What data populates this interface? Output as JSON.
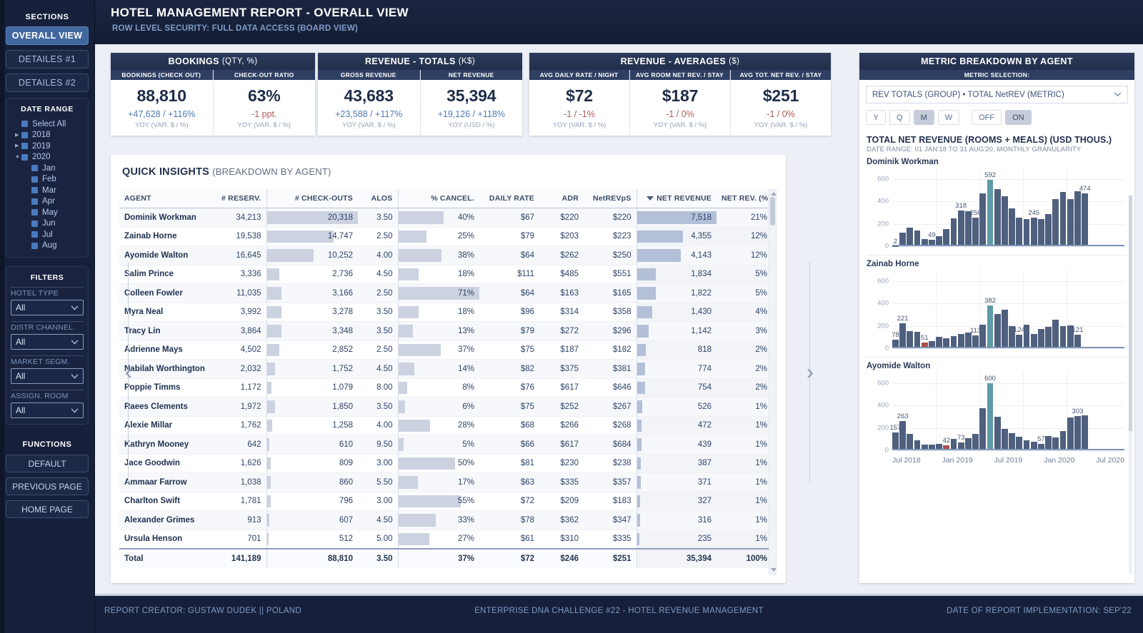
{
  "header": {
    "title": "HOTEL MANAGEMENT REPORT - OVERALL VIEW",
    "subtitle": "ROW LEVEL SECURITY: FULL DATA ACCESS (BOARD VIEW)"
  },
  "sidebar": {
    "sections_title": "SECTIONS",
    "sections": [
      {
        "label": "OVERALL VIEW",
        "active": true
      },
      {
        "label": "DETAILES #1",
        "active": false
      },
      {
        "label": "DETAILES #2",
        "active": false
      }
    ],
    "date_range_title": "DATE RANGE",
    "date_tree": [
      {
        "label": "Select All",
        "level": 1,
        "arrow": ""
      },
      {
        "label": "2018",
        "level": 1,
        "arrow": "collapsed"
      },
      {
        "label": "2019",
        "level": 1,
        "arrow": "collapsed"
      },
      {
        "label": "2020",
        "level": 1,
        "arrow": "expanded"
      },
      {
        "label": "Jan",
        "level": 2,
        "arrow": ""
      },
      {
        "label": "Feb",
        "level": 2,
        "arrow": ""
      },
      {
        "label": "Mar",
        "level": 2,
        "arrow": ""
      },
      {
        "label": "Apr",
        "level": 2,
        "arrow": ""
      },
      {
        "label": "May",
        "level": 2,
        "arrow": ""
      },
      {
        "label": "Jun",
        "level": 2,
        "arrow": ""
      },
      {
        "label": "Jul",
        "level": 2,
        "arrow": ""
      },
      {
        "label": "Aug",
        "level": 2,
        "arrow": ""
      }
    ],
    "filters_title": "FILTERS",
    "filters": [
      {
        "label": "HOTEL TYPE",
        "value": "All"
      },
      {
        "label": "DISTR CHANNEL.",
        "value": "All"
      },
      {
        "label": "MARKET SEGM.",
        "value": "All"
      },
      {
        "label": "ASSIGN. ROOM",
        "value": "All"
      }
    ],
    "functions_title": "FUNCTIONS",
    "functions": [
      {
        "label": "DEFAULT"
      },
      {
        "label": "PREVIOUS PAGE"
      },
      {
        "label": "HOME PAGE"
      }
    ]
  },
  "kpi_groups": [
    {
      "title": "BOOKINGS",
      "title_light": "(QTY, %)",
      "cells": [
        {
          "head": "BOOKINGS (CHECK OUT)",
          "value": "88,810",
          "delta": "+47,628 / +116%",
          "delta_sign": "pos",
          "note": "YOY (VAR. $ / %)"
        },
        {
          "head": "CHECK-OUT RATIO",
          "value": "63%",
          "delta": "-1 ppt.",
          "delta_sign": "neg",
          "note": "YOY (VAR. $ / %)"
        }
      ]
    },
    {
      "title": "REVENUE - TOTALS",
      "title_light": "(K$)",
      "cells": [
        {
          "head": "GROSS REVENUE",
          "value": "43,683",
          "delta": "+23,588 / +117%",
          "delta_sign": "pos",
          "note": "YOY (VAR. $ / %)"
        },
        {
          "head": "NET REVENUE",
          "value": "35,394",
          "delta": "+19,126 / +118%",
          "delta_sign": "pos",
          "note": "YOY (USD / %)"
        }
      ]
    },
    {
      "title": "REVENUE - AVERAGES",
      "title_light": "($)",
      "cells": [
        {
          "head": "AVG DAILY RATE / NIGHT",
          "value": "$72",
          "delta": "-1 / -1%",
          "delta_sign": "neg",
          "note": "YOY (VAR. $ / %)"
        },
        {
          "head": "AVG ROOM NET REV. / STAY",
          "value": "$187",
          "delta": "-1 / 0%",
          "delta_sign": "neg",
          "note": "YOY (VAR. $ / %)"
        },
        {
          "head": "AVG TOT. NET REV. / STAY",
          "value": "$251",
          "delta": "-1 / 0%",
          "delta_sign": "neg",
          "note": "YOY (VAR. $ / %)"
        }
      ]
    }
  ],
  "table": {
    "title": "QUICK INSIGHTS",
    "title_light": "(BREAKDOWN BY AGENT)",
    "columns": [
      "AGENT",
      "# RESERV.",
      "# CHECK-OUTS",
      "ALOS",
      "% CANCEL.",
      "DAILY RATE",
      "ADR",
      "NetREVpS",
      "NET REVENUE",
      "NET REV. (%)"
    ],
    "sorted_column": "NET REVENUE",
    "rows": [
      {
        "agent": "Dominik Workman",
        "reserv": "34,213",
        "checkouts": "20,318",
        "checkouts_pct": 100,
        "alos": "3.50",
        "cancel": "40%",
        "cancel_pct": 56,
        "daily_rate": "$67",
        "adr": "$220",
        "netrevps": "$220",
        "net_revenue": "7,518",
        "netrev_pct": 100,
        "net_rev_share": "21%"
      },
      {
        "agent": "Zainab Horne",
        "reserv": "19,538",
        "checkouts": "14,747",
        "checkouts_pct": 73,
        "alos": "2.50",
        "cancel": "25%",
        "cancel_pct": 35,
        "daily_rate": "$79",
        "adr": "$203",
        "netrevps": "$223",
        "net_revenue": "4,355",
        "netrev_pct": 58,
        "net_rev_share": "12%"
      },
      {
        "agent": "Ayomide Walton",
        "reserv": "16,645",
        "checkouts": "10,252",
        "checkouts_pct": 51,
        "alos": "4.00",
        "cancel": "38%",
        "cancel_pct": 53,
        "daily_rate": "$64",
        "adr": "$262",
        "netrevps": "$250",
        "net_revenue": "4,143",
        "netrev_pct": 55,
        "net_rev_share": "12%"
      },
      {
        "agent": "Salim Prince",
        "reserv": "3,336",
        "checkouts": "2,736",
        "checkouts_pct": 14,
        "alos": "4.50",
        "cancel": "18%",
        "cancel_pct": 25,
        "daily_rate": "$111",
        "adr": "$485",
        "netrevps": "$551",
        "net_revenue": "1,834",
        "netrev_pct": 24,
        "net_rev_share": "5%"
      },
      {
        "agent": "Colleen Fowler",
        "reserv": "11,035",
        "checkouts": "3,166",
        "checkouts_pct": 16,
        "alos": "2.50",
        "cancel": "71%",
        "cancel_pct": 100,
        "daily_rate": "$64",
        "adr": "$163",
        "netrevps": "$165",
        "net_revenue": "1,822",
        "netrev_pct": 24,
        "net_rev_share": "5%"
      },
      {
        "agent": "Myra Neal",
        "reserv": "3,992",
        "checkouts": "3,278",
        "checkouts_pct": 16,
        "alos": "3.50",
        "cancel": "18%",
        "cancel_pct": 25,
        "daily_rate": "$96",
        "adr": "$314",
        "netrevps": "$358",
        "net_revenue": "1,430",
        "netrev_pct": 19,
        "net_rev_share": "4%"
      },
      {
        "agent": "Tracy Lin",
        "reserv": "3,864",
        "checkouts": "3,348",
        "checkouts_pct": 16,
        "alos": "3.50",
        "cancel": "13%",
        "cancel_pct": 18,
        "daily_rate": "$79",
        "adr": "$272",
        "netrevps": "$296",
        "net_revenue": "1,142",
        "netrev_pct": 15,
        "net_rev_share": "3%"
      },
      {
        "agent": "Adrienne Mays",
        "reserv": "4,502",
        "checkouts": "2,852",
        "checkouts_pct": 14,
        "alos": "2.50",
        "cancel": "37%",
        "cancel_pct": 52,
        "daily_rate": "$75",
        "adr": "$187",
        "netrevps": "$182",
        "net_revenue": "818",
        "netrev_pct": 11,
        "net_rev_share": "2%"
      },
      {
        "agent": "Nabilah Worthington",
        "reserv": "2,032",
        "checkouts": "1,752",
        "checkouts_pct": 9,
        "alos": "4.50",
        "cancel": "14%",
        "cancel_pct": 20,
        "daily_rate": "$82",
        "adr": "$375",
        "netrevps": "$381",
        "net_revenue": "774",
        "netrev_pct": 10,
        "net_rev_share": "2%"
      },
      {
        "agent": "Poppie Timms",
        "reserv": "1,172",
        "checkouts": "1,079",
        "checkouts_pct": 5,
        "alos": "8.00",
        "cancel": "8%",
        "cancel_pct": 11,
        "daily_rate": "$76",
        "adr": "$617",
        "netrevps": "$646",
        "net_revenue": "754",
        "netrev_pct": 10,
        "net_rev_share": "2%"
      },
      {
        "agent": "Raees Clements",
        "reserv": "1,972",
        "checkouts": "1,850",
        "checkouts_pct": 9,
        "alos": "3.50",
        "cancel": "6%",
        "cancel_pct": 8,
        "daily_rate": "$75",
        "adr": "$252",
        "netrevps": "$267",
        "net_revenue": "526",
        "netrev_pct": 7,
        "net_rev_share": "1%"
      },
      {
        "agent": "Alexie Millar",
        "reserv": "1,762",
        "checkouts": "1,258",
        "checkouts_pct": 6,
        "alos": "4.00",
        "cancel": "28%",
        "cancel_pct": 39,
        "daily_rate": "$68",
        "adr": "$266",
        "netrevps": "$268",
        "net_revenue": "472",
        "netrev_pct": 6,
        "net_rev_share": "1%"
      },
      {
        "agent": "Kathryn Mooney",
        "reserv": "642",
        "checkouts": "610",
        "checkouts_pct": 3,
        "alos": "9.50",
        "cancel": "5%",
        "cancel_pct": 7,
        "daily_rate": "$66",
        "adr": "$617",
        "netrevps": "$684",
        "net_revenue": "439",
        "netrev_pct": 6,
        "net_rev_share": "1%"
      },
      {
        "agent": "Jace Goodwin",
        "reserv": "1,626",
        "checkouts": "809",
        "checkouts_pct": 4,
        "alos": "3.00",
        "cancel": "50%",
        "cancel_pct": 70,
        "daily_rate": "$81",
        "adr": "$230",
        "netrevps": "$238",
        "net_revenue": "387",
        "netrev_pct": 5,
        "net_rev_share": "1%"
      },
      {
        "agent": "Ammaar Farrow",
        "reserv": "1,038",
        "checkouts": "860",
        "checkouts_pct": 4,
        "alos": "5.50",
        "cancel": "17%",
        "cancel_pct": 24,
        "daily_rate": "$63",
        "adr": "$335",
        "netrevps": "$357",
        "net_revenue": "371",
        "netrev_pct": 5,
        "net_rev_share": "1%"
      },
      {
        "agent": "Charlton Swift",
        "reserv": "1,781",
        "checkouts": "796",
        "checkouts_pct": 4,
        "alos": "3.00",
        "cancel": "55%",
        "cancel_pct": 77,
        "daily_rate": "$72",
        "adr": "$209",
        "netrevps": "$183",
        "net_revenue": "327",
        "netrev_pct": 4,
        "net_rev_share": "1%"
      },
      {
        "agent": "Alexander Grimes",
        "reserv": "913",
        "checkouts": "607",
        "checkouts_pct": 3,
        "alos": "4.50",
        "cancel": "33%",
        "cancel_pct": 46,
        "daily_rate": "$78",
        "adr": "$362",
        "netrevps": "$347",
        "net_revenue": "316",
        "netrev_pct": 4,
        "net_rev_share": "1%"
      },
      {
        "agent": "Ursula Henson",
        "reserv": "701",
        "checkouts": "512",
        "checkouts_pct": 2,
        "alos": "5.00",
        "cancel": "27%",
        "cancel_pct": 38,
        "daily_rate": "$61",
        "adr": "$310",
        "netrevps": "$335",
        "net_revenue": "235",
        "netrev_pct": 3,
        "net_rev_share": "1%"
      }
    ],
    "total": {
      "agent": "Total",
      "reserv": "141,189",
      "checkouts": "88,810",
      "alos": "3.50",
      "cancel": "37%",
      "daily_rate": "$72",
      "adr": "$246",
      "netrevps": "$251",
      "net_revenue": "35,394",
      "net_rev_share": "100%"
    }
  },
  "right_panel": {
    "title": "METRIC BREAKDOWN BY AGENT",
    "subtitle": "METRIC SELECTION:",
    "metric_value": "REV TOTALS (GROUP) • TOTAL NetREV (METRIC)",
    "granularity_pills": [
      {
        "label": "Y",
        "on": false
      },
      {
        "label": "Q",
        "on": false
      },
      {
        "label": "M",
        "on": true
      },
      {
        "label": "W",
        "on": false
      }
    ],
    "toggle_pills": [
      {
        "label": "OFF",
        "on": false
      },
      {
        "label": "ON",
        "on": true
      }
    ],
    "chart_title": "TOTAL NET REVENUE (ROOMS + MEALS) (USD THOUS.)",
    "chart_subtitle": "DATE RANGE: 01 JAN'18 TO 31 AUG'20, MONTHLY GRANULARITY",
    "x_ticks": [
      "Jul 2018",
      "Jan 2019",
      "Jul 2019",
      "Jan 2020",
      "Jul 2020"
    ]
  },
  "chart_data": [
    {
      "type": "bar",
      "title": "Dominik Workman",
      "ylabel": "USD thousands",
      "xlabel": "",
      "ylim": [
        0,
        700
      ],
      "yticks": [
        0,
        200,
        400,
        600
      ],
      "grid": true,
      "highlight_color": "#5f9aa8",
      "bar_color": "#4f5f7e",
      "negative_color": "#a8504b",
      "x": [
        "Jan 2018",
        "Feb 2018",
        "Mar 2018",
        "Apr 2018",
        "May 2018",
        "Jun 2018",
        "Jul 2018",
        "Aug 2018",
        "Sep 2018",
        "Oct 2018",
        "Nov 2018",
        "Dec 2018",
        "Jan 2019",
        "Feb 2019",
        "Mar 2019",
        "Apr 2019",
        "May 2019",
        "Jun 2019",
        "Jul 2019",
        "Aug 2019",
        "Sep 2019",
        "Oct 2019",
        "Nov 2019",
        "Dec 2019",
        "Jan 2020",
        "Feb 2020",
        "Mar 2020",
        "Apr 2020",
        "May 2020",
        "Jun 2020",
        "Jul 2020",
        "Aug 2020"
      ],
      "values": [
        2,
        120,
        165,
        143,
        62,
        58,
        90,
        150,
        250,
        318,
        310,
        256,
        468,
        592,
        512,
        447,
        338,
        253,
        245,
        252,
        243,
        284,
        421,
        482,
        418,
        490,
        474,
        0,
        0,
        0,
        0,
        0
      ],
      "labels": {
        "0": "2",
        "5": "49",
        "9": "318",
        "11": "256",
        "13": "592",
        "19": "245",
        "26": "474"
      },
      "highlight_index": 13
    },
    {
      "type": "bar",
      "title": "Zainab Horne",
      "ylabel": "USD thousands",
      "xlabel": "",
      "ylim": [
        0,
        700
      ],
      "yticks": [
        0,
        200,
        400,
        600
      ],
      "grid": true,
      "highlight_color": "#5f9aa8",
      "bar_color": "#4f5f7e",
      "negative_color": "#a8504b",
      "x": [
        "Jan 2018",
        "Feb 2018",
        "Mar 2018",
        "Apr 2018",
        "May 2018",
        "Jun 2018",
        "Jul 2018",
        "Aug 2018",
        "Sep 2018",
        "Oct 2018",
        "Nov 2018",
        "Dec 2018",
        "Jan 2019",
        "Feb 2019",
        "Mar 2019",
        "Apr 2019",
        "May 2019",
        "Jun 2019",
        "Jul 2019",
        "Aug 2019",
        "Sep 2019",
        "Oct 2019",
        "Nov 2019",
        "Dec 2019",
        "Jan 2020",
        "Feb 2020",
        "Mar 2020",
        "Apr 2020",
        "May 2020",
        "Jun 2020",
        "Jul 2020",
        "Aug 2020"
      ],
      "values": [
        78,
        221,
        152,
        148,
        51,
        62,
        103,
        92,
        110,
        126,
        143,
        113,
        213,
        382,
        305,
        345,
        196,
        124,
        213,
        125,
        172,
        188,
        252,
        196,
        205,
        121,
        0,
        0,
        0,
        0,
        0,
        0
      ],
      "labels": {
        "0": "78",
        "1": "221",
        "4": "51",
        "11": "113",
        "13": "382",
        "17": "124",
        "25": "121"
      },
      "highlight_index": 13,
      "negative_index": 4
    },
    {
      "type": "bar",
      "title": "Ayomide Walton",
      "ylabel": "USD thousands",
      "xlabel": "",
      "ylim": [
        0,
        700
      ],
      "yticks": [
        0,
        200,
        400,
        600
      ],
      "grid": true,
      "highlight_color": "#5f9aa8",
      "bar_color": "#4f5f7e",
      "negative_color": "#a8504b",
      "x": [
        "Jan 2018",
        "Feb 2018",
        "Mar 2018",
        "Apr 2018",
        "May 2018",
        "Jun 2018",
        "Jul 2018",
        "Aug 2018",
        "Sep 2018",
        "Oct 2018",
        "Nov 2018",
        "Dec 2018",
        "Jan 2019",
        "Feb 2019",
        "Mar 2019",
        "Apr 2019",
        "May 2019",
        "Jun 2019",
        "Jul 2019",
        "Aug 2019",
        "Sep 2019",
        "Oct 2019",
        "Nov 2019",
        "Dec 2019",
        "Jan 2020",
        "Feb 2020",
        "Mar 2020",
        "Apr 2020",
        "May 2020",
        "Jun 2020",
        "Jul 2020",
        "Aug 2020"
      ],
      "values": [
        157,
        263,
        145,
        90,
        50,
        50,
        57,
        42,
        103,
        73,
        110,
        148,
        373,
        600,
        300,
        188,
        150,
        122,
        90,
        75,
        57,
        125,
        113,
        172,
        290,
        303,
        310,
        0,
        0,
        0,
        0,
        0
      ],
      "labels": {
        "0": "157",
        "1": "263",
        "7": "42",
        "9": "73",
        "13": "600",
        "20": "57",
        "25": "303"
      },
      "highlight_index": 13,
      "negative_index": 7
    }
  ],
  "footer": {
    "left": "REPORT CREATOR: GUSTAW DUDEK || POLAND",
    "center": "ENTERPRISE DNA CHALLENGE #22 - HOTEL REVENUE MANAGEMENT",
    "right": "DATE OF REPORT IMPLEMENTATION: SEP'22"
  }
}
